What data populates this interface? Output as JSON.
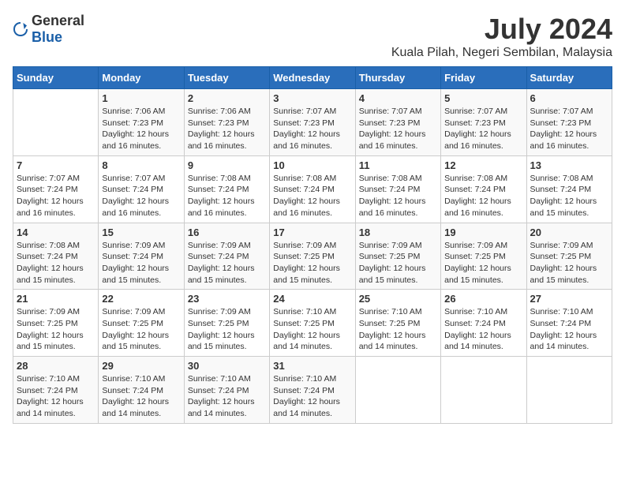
{
  "logo": {
    "text_general": "General",
    "text_blue": "Blue"
  },
  "title": "July 2024",
  "location": "Kuala Pilah, Negeri Sembilan, Malaysia",
  "days_of_week": [
    "Sunday",
    "Monday",
    "Tuesday",
    "Wednesday",
    "Thursday",
    "Friday",
    "Saturday"
  ],
  "weeks": [
    [
      {
        "day": "",
        "info": ""
      },
      {
        "day": "1",
        "info": "Sunrise: 7:06 AM\nSunset: 7:23 PM\nDaylight: 12 hours and 16 minutes."
      },
      {
        "day": "2",
        "info": "Sunrise: 7:06 AM\nSunset: 7:23 PM\nDaylight: 12 hours and 16 minutes."
      },
      {
        "day": "3",
        "info": "Sunrise: 7:07 AM\nSunset: 7:23 PM\nDaylight: 12 hours and 16 minutes."
      },
      {
        "day": "4",
        "info": "Sunrise: 7:07 AM\nSunset: 7:23 PM\nDaylight: 12 hours and 16 minutes."
      },
      {
        "day": "5",
        "info": "Sunrise: 7:07 AM\nSunset: 7:23 PM\nDaylight: 12 hours and 16 minutes."
      },
      {
        "day": "6",
        "info": "Sunrise: 7:07 AM\nSunset: 7:23 PM\nDaylight: 12 hours and 16 minutes."
      }
    ],
    [
      {
        "day": "7",
        "info": "Sunrise: 7:07 AM\nSunset: 7:24 PM\nDaylight: 12 hours and 16 minutes."
      },
      {
        "day": "8",
        "info": "Sunrise: 7:07 AM\nSunset: 7:24 PM\nDaylight: 12 hours and 16 minutes."
      },
      {
        "day": "9",
        "info": "Sunrise: 7:08 AM\nSunset: 7:24 PM\nDaylight: 12 hours and 16 minutes."
      },
      {
        "day": "10",
        "info": "Sunrise: 7:08 AM\nSunset: 7:24 PM\nDaylight: 12 hours and 16 minutes."
      },
      {
        "day": "11",
        "info": "Sunrise: 7:08 AM\nSunset: 7:24 PM\nDaylight: 12 hours and 16 minutes."
      },
      {
        "day": "12",
        "info": "Sunrise: 7:08 AM\nSunset: 7:24 PM\nDaylight: 12 hours and 16 minutes."
      },
      {
        "day": "13",
        "info": "Sunrise: 7:08 AM\nSunset: 7:24 PM\nDaylight: 12 hours and 15 minutes."
      }
    ],
    [
      {
        "day": "14",
        "info": "Sunrise: 7:08 AM\nSunset: 7:24 PM\nDaylight: 12 hours and 15 minutes."
      },
      {
        "day": "15",
        "info": "Sunrise: 7:09 AM\nSunset: 7:24 PM\nDaylight: 12 hours and 15 minutes."
      },
      {
        "day": "16",
        "info": "Sunrise: 7:09 AM\nSunset: 7:24 PM\nDaylight: 12 hours and 15 minutes."
      },
      {
        "day": "17",
        "info": "Sunrise: 7:09 AM\nSunset: 7:25 PM\nDaylight: 12 hours and 15 minutes."
      },
      {
        "day": "18",
        "info": "Sunrise: 7:09 AM\nSunset: 7:25 PM\nDaylight: 12 hours and 15 minutes."
      },
      {
        "day": "19",
        "info": "Sunrise: 7:09 AM\nSunset: 7:25 PM\nDaylight: 12 hours and 15 minutes."
      },
      {
        "day": "20",
        "info": "Sunrise: 7:09 AM\nSunset: 7:25 PM\nDaylight: 12 hours and 15 minutes."
      }
    ],
    [
      {
        "day": "21",
        "info": "Sunrise: 7:09 AM\nSunset: 7:25 PM\nDaylight: 12 hours and 15 minutes."
      },
      {
        "day": "22",
        "info": "Sunrise: 7:09 AM\nSunset: 7:25 PM\nDaylight: 12 hours and 15 minutes."
      },
      {
        "day": "23",
        "info": "Sunrise: 7:09 AM\nSunset: 7:25 PM\nDaylight: 12 hours and 15 minutes."
      },
      {
        "day": "24",
        "info": "Sunrise: 7:10 AM\nSunset: 7:25 PM\nDaylight: 12 hours and 14 minutes."
      },
      {
        "day": "25",
        "info": "Sunrise: 7:10 AM\nSunset: 7:25 PM\nDaylight: 12 hours and 14 minutes."
      },
      {
        "day": "26",
        "info": "Sunrise: 7:10 AM\nSunset: 7:24 PM\nDaylight: 12 hours and 14 minutes."
      },
      {
        "day": "27",
        "info": "Sunrise: 7:10 AM\nSunset: 7:24 PM\nDaylight: 12 hours and 14 minutes."
      }
    ],
    [
      {
        "day": "28",
        "info": "Sunrise: 7:10 AM\nSunset: 7:24 PM\nDaylight: 12 hours and 14 minutes."
      },
      {
        "day": "29",
        "info": "Sunrise: 7:10 AM\nSunset: 7:24 PM\nDaylight: 12 hours and 14 minutes."
      },
      {
        "day": "30",
        "info": "Sunrise: 7:10 AM\nSunset: 7:24 PM\nDaylight: 12 hours and 14 minutes."
      },
      {
        "day": "31",
        "info": "Sunrise: 7:10 AM\nSunset: 7:24 PM\nDaylight: 12 hours and 14 minutes."
      },
      {
        "day": "",
        "info": ""
      },
      {
        "day": "",
        "info": ""
      },
      {
        "day": "",
        "info": ""
      }
    ]
  ]
}
